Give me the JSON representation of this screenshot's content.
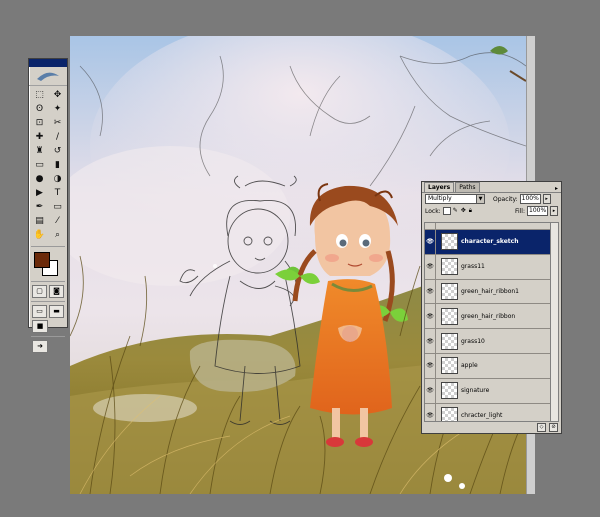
{
  "tools": {
    "icons": [
      "marquee-icon",
      "move-icon",
      "lasso-icon",
      "magic-wand-icon",
      "crop-icon",
      "slice-icon",
      "healing-icon",
      "brush-icon",
      "clone-stamp-icon",
      "history-brush-icon",
      "eraser-icon",
      "gradient-icon",
      "blur-icon",
      "dodge-icon",
      "path-select-icon",
      "type-icon",
      "pen-icon",
      "shape-icon",
      "notes-icon",
      "eyedropper-icon",
      "hand-icon",
      "zoom-icon"
    ],
    "glyphs": [
      "⬚",
      "✥",
      "ʘ",
      "✦",
      "⊡",
      "✂",
      "✚",
      "/",
      "♜",
      "↺",
      "▭",
      "▮",
      "●",
      "◑",
      "▶",
      "T",
      "✒",
      "▭",
      "▤",
      "⁄",
      "✋",
      "⌕"
    ],
    "foreground_color": "#6b2a0a",
    "background_color": "#ffffff"
  },
  "layers_panel": {
    "tabs": [
      "Layers",
      "Paths"
    ],
    "blend_mode": "Multiply",
    "opacity_label": "Opacity:",
    "opacity_value": "100%",
    "lock_label": "Lock:",
    "fill_label": "Fill:",
    "fill_value": "100%",
    "layers": [
      {
        "name": "character_sketch",
        "selected": true
      },
      {
        "name": "grass11",
        "selected": false
      },
      {
        "name": "green_hair_ribbon1",
        "selected": false
      },
      {
        "name": "green_hair_ribbon",
        "selected": false
      },
      {
        "name": "grass10",
        "selected": false
      },
      {
        "name": "apple",
        "selected": false
      },
      {
        "name": "signature",
        "selected": false
      },
      {
        "name": "chracter_light",
        "selected": false
      }
    ]
  }
}
